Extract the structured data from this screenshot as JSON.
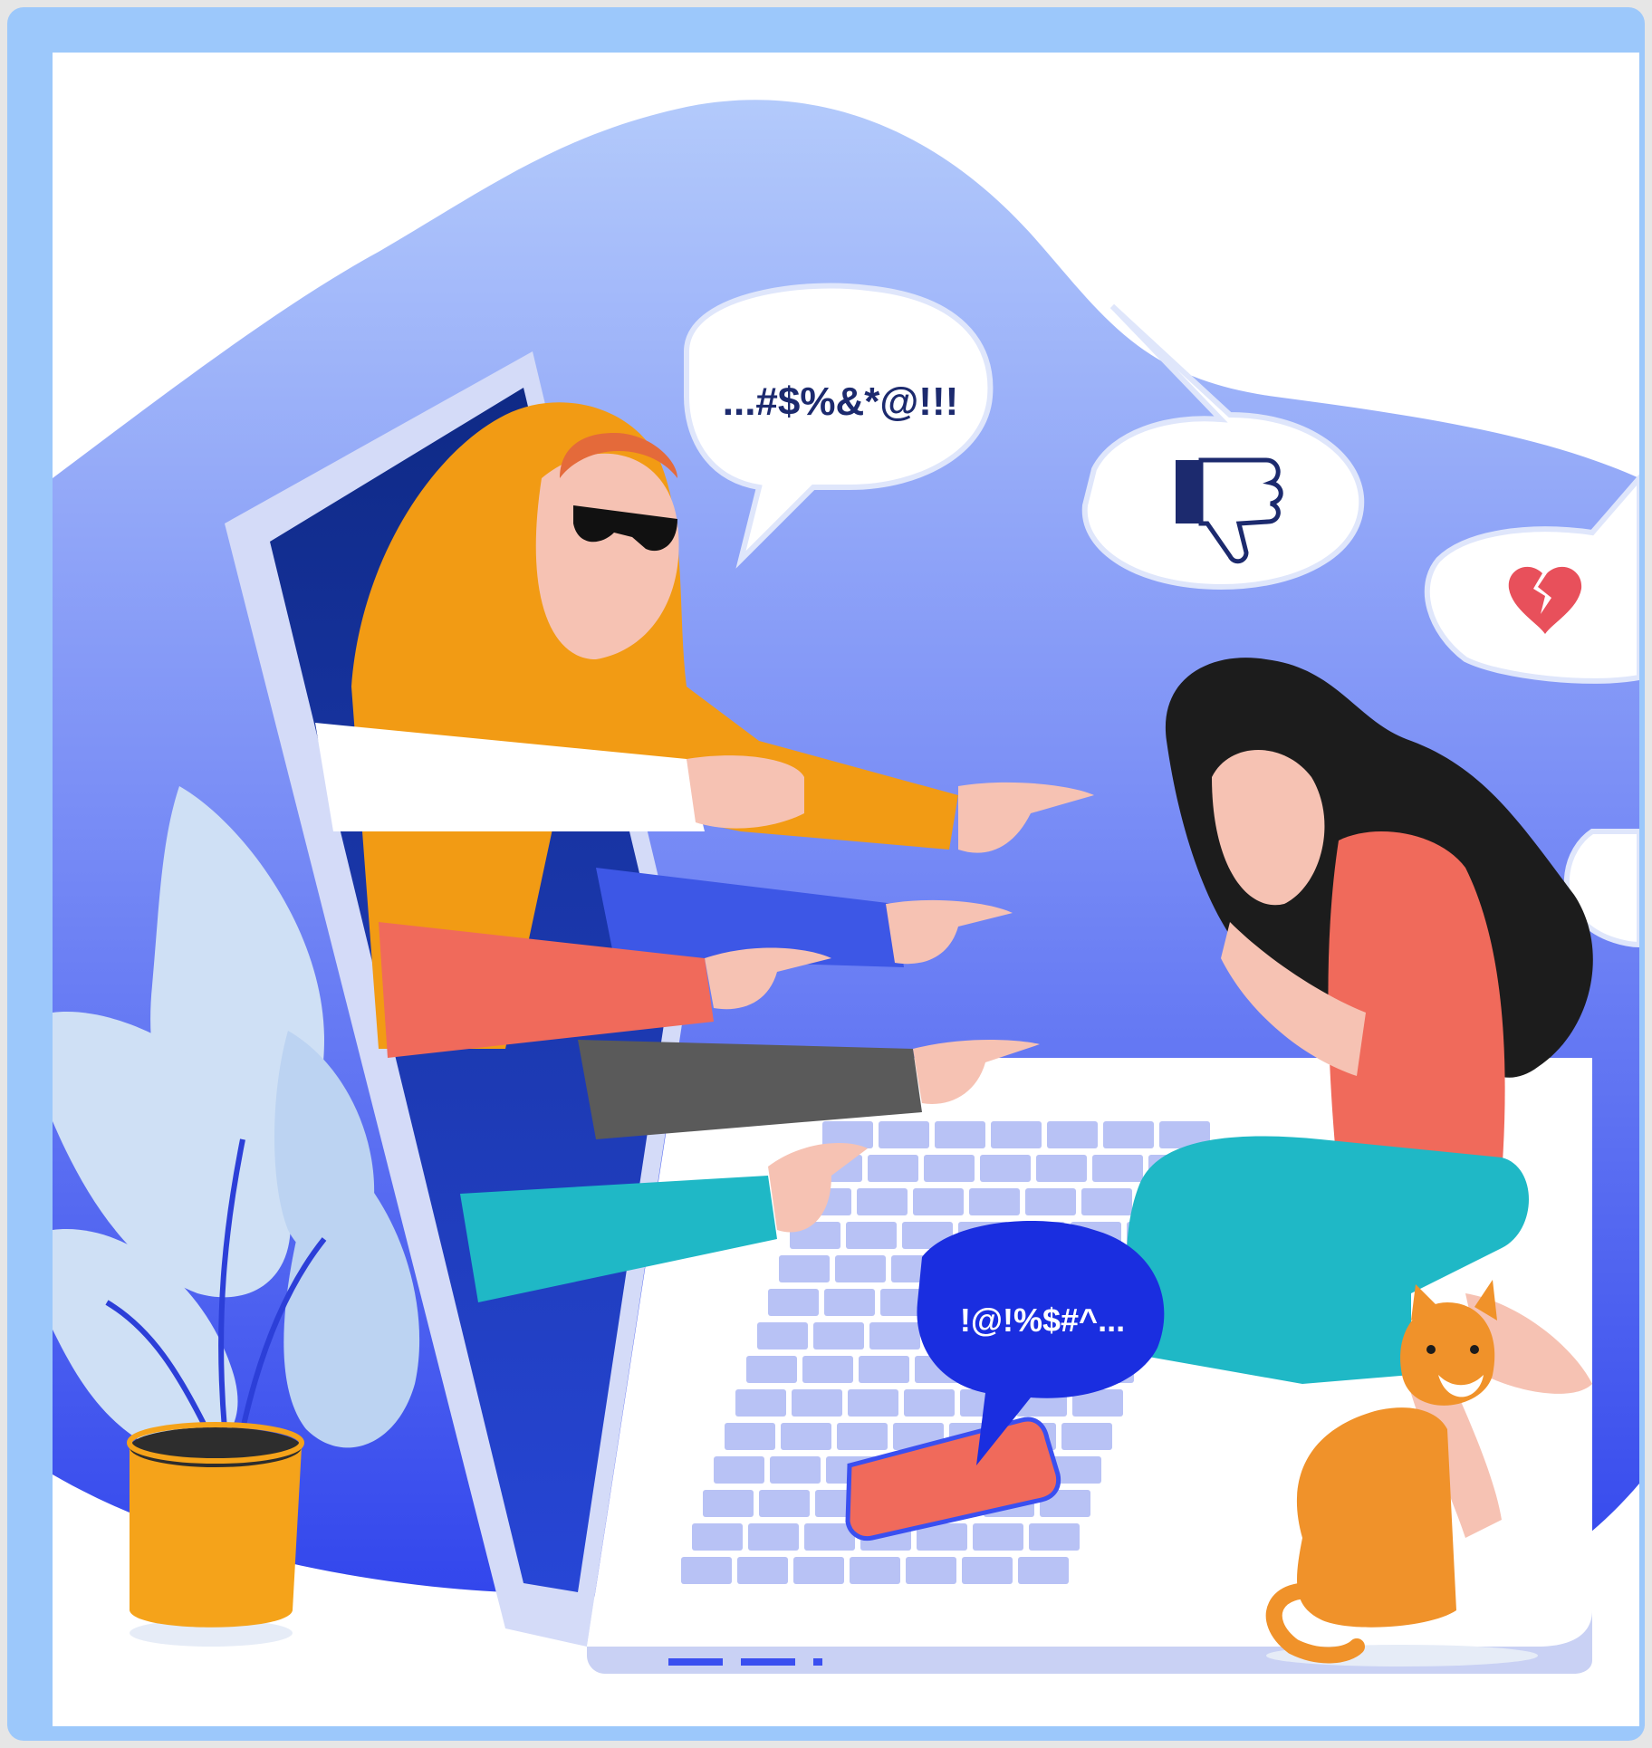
{
  "illustration": {
    "speech_bubble_top": "...#$%&*@!!!",
    "speech_bubble_bottom": "!@!%$#^...",
    "icons": [
      "thumbs-down-icon",
      "broken-heart-icon"
    ],
    "colors": {
      "frame": "#9cc8fb",
      "background": "#ffffff",
      "blob_top": "#a9c2fb",
      "blob_bottom": "#3a4ff0",
      "hoodie": "#f29b14",
      "shirt_woman": "#f06a5b",
      "pants_woman": "#1fb8c6",
      "hair": "#1c1c1c",
      "cat": "#f0922a",
      "laptop": "#ffffff",
      "keys": "#b8c2f5",
      "plant": "#cfe0f5",
      "pot": "#f5a31a",
      "bubble_dark": "#1a2ee0"
    }
  }
}
